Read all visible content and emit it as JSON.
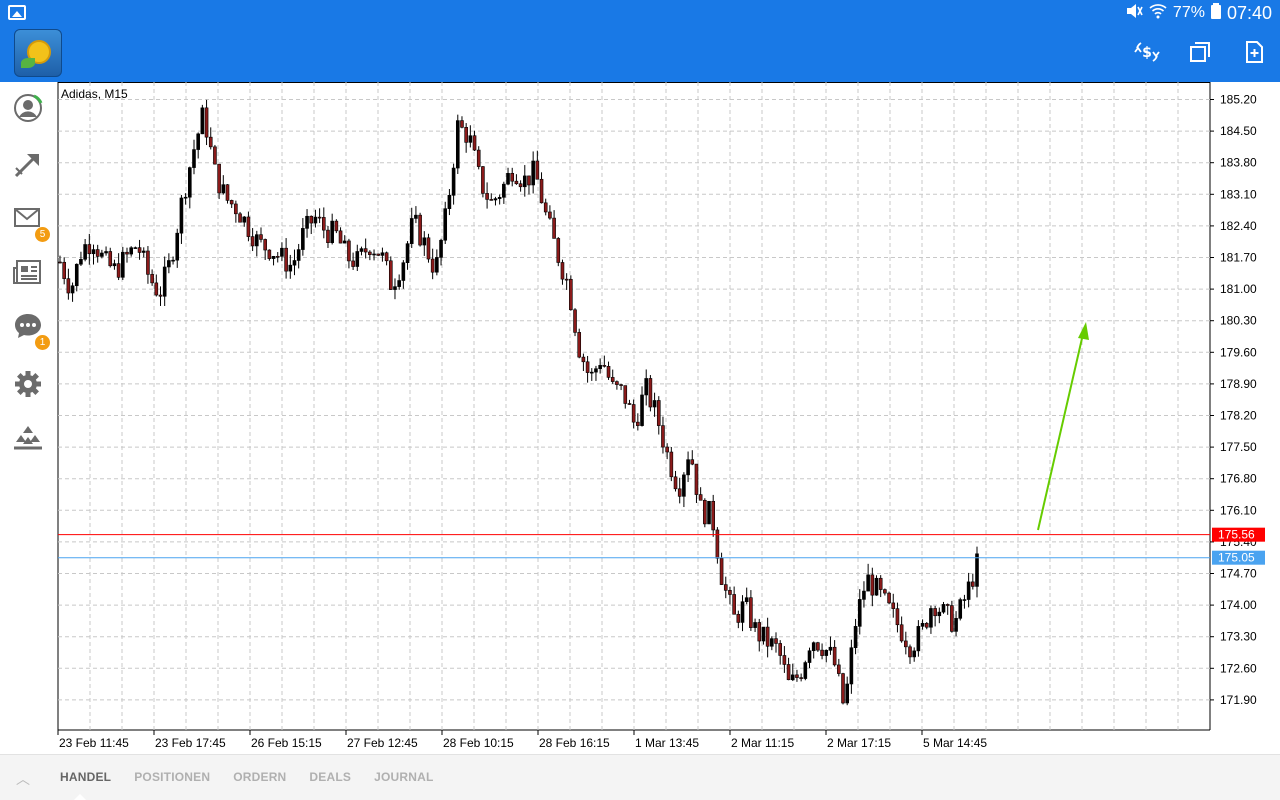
{
  "status_bar": {
    "battery_percent": "77%",
    "time": "07:40"
  },
  "app_bar": {
    "logo": "metatrader-logo",
    "actions": [
      "currency-icon",
      "windows-icon",
      "new-document-icon"
    ]
  },
  "sidebar": {
    "items": [
      {
        "icon": "account-icon",
        "badge": ""
      },
      {
        "icon": "trade-icon",
        "badge": ""
      },
      {
        "icon": "mail-icon",
        "badge": "5"
      },
      {
        "icon": "news-icon",
        "badge": ""
      },
      {
        "icon": "chat-icon",
        "badge": "1"
      },
      {
        "icon": "settings-icon",
        "badge": ""
      },
      {
        "icon": "community-icon",
        "badge": ""
      }
    ]
  },
  "chart": {
    "title": "Adidas, M15",
    "price_labels": [
      "185.20",
      "184.50",
      "183.80",
      "183.10",
      "182.40",
      "181.70",
      "181.00",
      "180.30",
      "179.60",
      "178.90",
      "178.20",
      "177.50",
      "176.80",
      "176.10",
      "175.40",
      "174.70",
      "174.00",
      "173.30",
      "172.60",
      "171.90"
    ],
    "time_labels": [
      "23 Feb 11:45",
      "23 Feb 17:45",
      "26 Feb 15:15",
      "27 Feb 12:45",
      "28 Feb 10:15",
      "28 Feb 16:15",
      "1 Mar 13:45",
      "2 Mar 11:15",
      "2 Mar 17:15",
      "5 Mar 14:45"
    ],
    "bid_line": {
      "value": "175.56",
      "color": "#ff0000"
    },
    "ask_line": {
      "value": "175.05",
      "color": "#4aa3f0"
    },
    "arrow_color": "#66cc00",
    "up_color": "#000000",
    "down_color": "#8b1a1a"
  },
  "chart_data": {
    "type": "candlestick",
    "title": "Adidas, M15",
    "symbol": "Adidas",
    "timeframe": "M15",
    "ylim": [
      171.5,
      185.5
    ],
    "grid": true,
    "close_path": [
      181.6,
      181.0,
      181.9,
      182.1,
      181.6,
      181.4,
      181.7,
      182.0,
      181.3,
      180.9,
      181.6,
      182.9,
      184.0,
      184.9,
      183.6,
      183.0,
      182.8,
      182.4,
      182.0,
      181.9,
      181.7,
      181.5,
      182.2,
      182.6,
      182.3,
      182.2,
      181.7,
      181.6,
      182.0,
      181.8,
      181.1,
      181.6,
      182.5,
      182.0,
      181.4,
      182.7,
      184.6,
      184.4,
      183.4,
      182.9,
      183.2,
      183.7,
      183.4,
      183.6,
      182.6,
      181.8,
      181.1,
      179.7,
      179.0,
      179.5,
      178.8,
      178.7,
      178.0,
      178.8,
      178.2,
      177.3,
      176.6,
      177.5,
      176.1,
      176.0,
      174.5,
      173.7,
      174.0,
      173.4,
      173.2,
      173.0,
      172.2,
      172.5,
      173.3,
      173.1,
      172.8,
      171.7,
      173.6,
      174.6,
      174.3,
      173.9,
      173.5,
      173.1,
      173.4,
      174.1,
      173.8,
      173.6,
      174.2,
      174.9
    ]
  },
  "bottom_tabs": [
    "HANDEL",
    "POSITIONEN",
    "ORDERN",
    "DEALS",
    "JOURNAL"
  ],
  "active_tab": "HANDEL"
}
